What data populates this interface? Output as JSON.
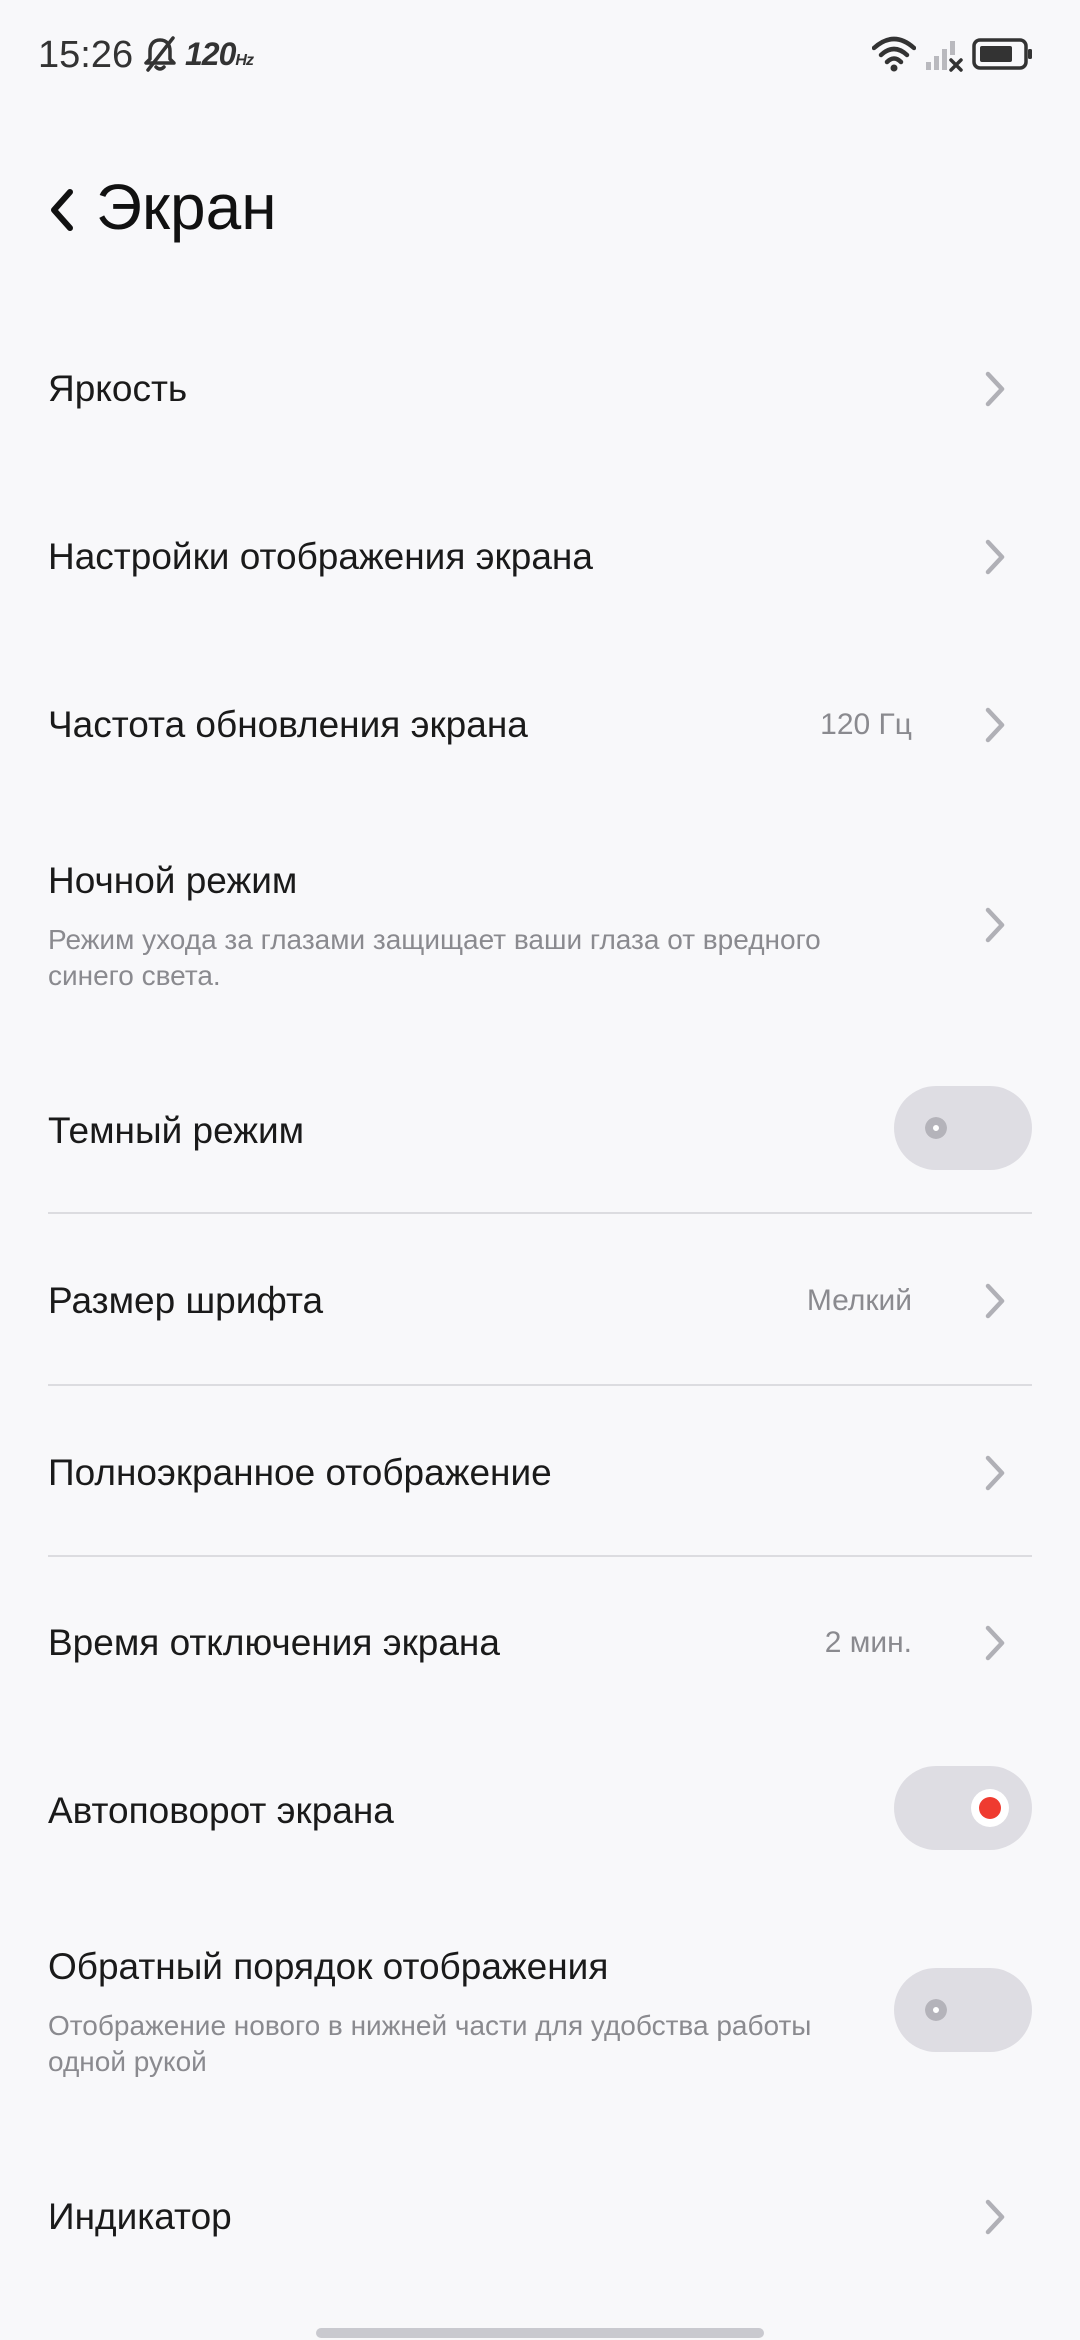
{
  "status_bar": {
    "time": "15:26",
    "refresh_badge": "120",
    "refresh_badge_unit": "Hz",
    "icons": [
      "mute-icon",
      "wifi-icon",
      "signal-icon",
      "battery-icon"
    ]
  },
  "header": {
    "title": "Экран",
    "back_icon": "chevron-left-icon"
  },
  "settings": {
    "brightness": {
      "title": "Яркость"
    },
    "display_settings": {
      "title": "Настройки отображения экрана"
    },
    "refresh_rate": {
      "title": "Частота обновления экрана",
      "value": "120 Гц"
    },
    "night_mode": {
      "title": "Ночной режим",
      "subtitle": "Режим ухода за глазами защищает ваши глаза от вредного синего света."
    },
    "dark_mode": {
      "title": "Темный режим",
      "enabled": false
    },
    "font_size": {
      "title": "Размер шрифта",
      "value": "Мелкий"
    },
    "fullscreen": {
      "title": "Полноэкранное отображение"
    },
    "screen_timeout": {
      "title": "Время отключения экрана",
      "value": "2 мин."
    },
    "auto_rotate": {
      "title": "Автоповорот экрана",
      "enabled": true
    },
    "reverse_order": {
      "title": "Обратный порядок отображения",
      "subtitle": "Отображение нового в нижней части для удобства работы одной рукой",
      "enabled": false
    },
    "indicator": {
      "title": "Индикатор"
    }
  },
  "colors": {
    "background": "#f8f8fa",
    "accent": "#ef3b30",
    "toggle_track": "#dedde3",
    "secondary_text": "#8a8a8f"
  }
}
